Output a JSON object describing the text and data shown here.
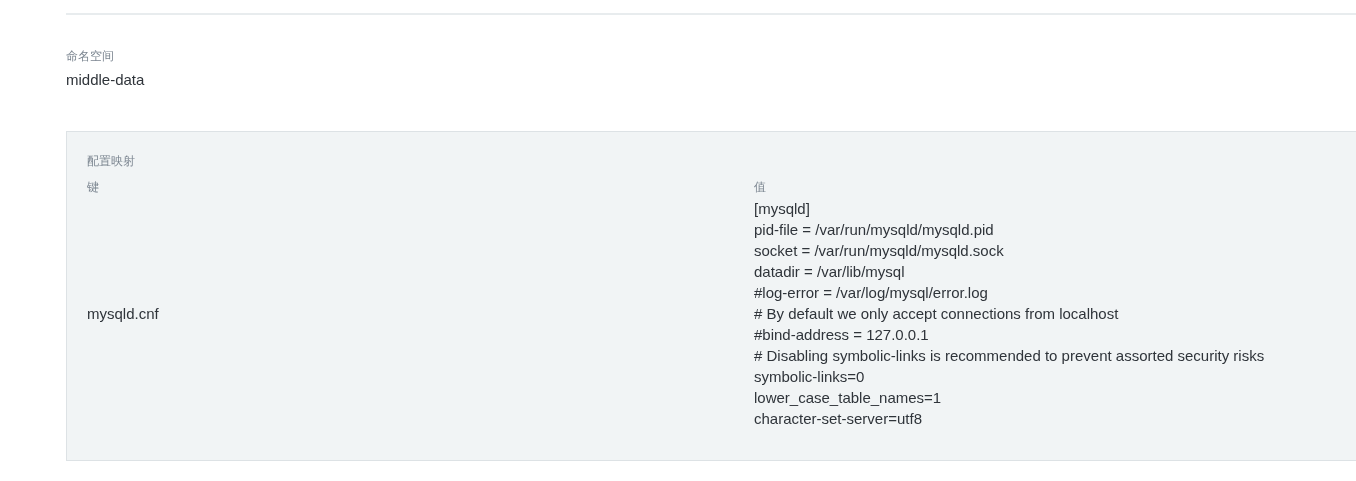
{
  "namespace": {
    "label": "命名空间",
    "value": "middle-data"
  },
  "config_map": {
    "title": "配置映射",
    "columns": [
      "键",
      "值"
    ],
    "rows": [
      {
        "key": "mysqld.cnf",
        "value_lines": [
          "[mysqld]",
          "pid-file = /var/run/mysqld/mysqld.pid",
          "socket = /var/run/mysqld/mysqld.sock",
          "datadir = /var/lib/mysql",
          "#log-error = /var/log/mysql/error.log",
          "# By default we only accept connections from localhost",
          "#bind-address = 127.0.0.1",
          "# Disabling symbolic-links is recommended to prevent assorted security risks",
          "symbolic-links=0",
          "lower_case_table_names=1",
          "character-set-server=utf8"
        ]
      }
    ]
  }
}
